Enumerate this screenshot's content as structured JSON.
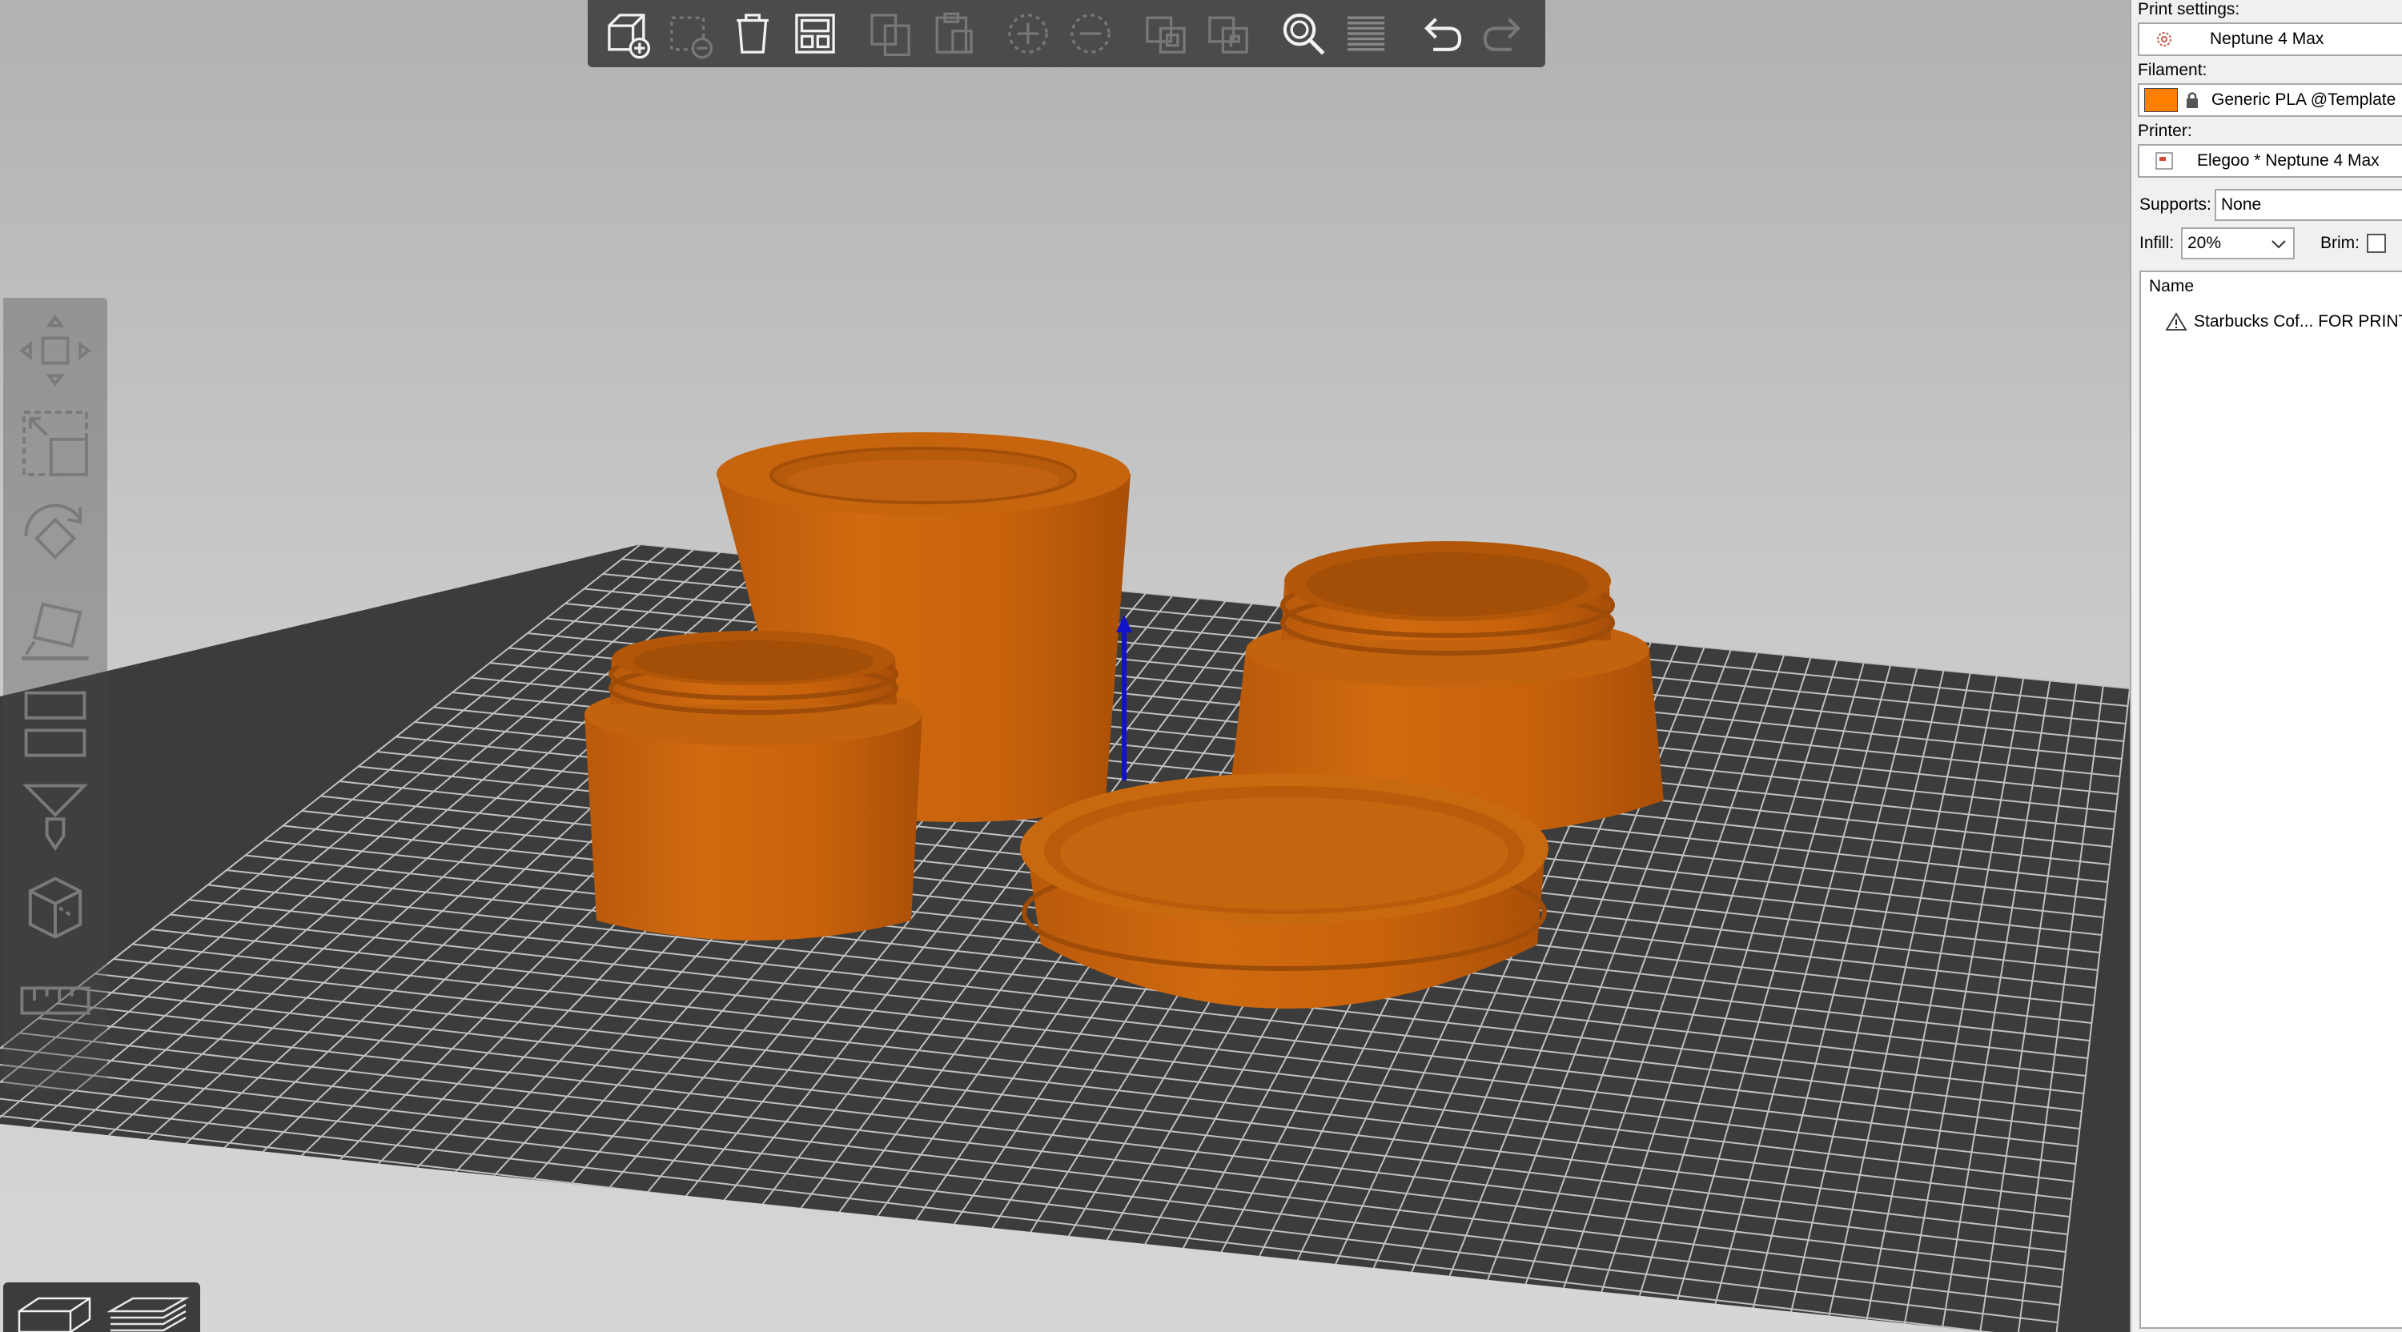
{
  "toolbar": {
    "buttons": [
      {
        "id": "add",
        "icon": "add-object-icon",
        "enabled": true
      },
      {
        "id": "delete",
        "icon": "delete-selection-icon",
        "enabled": false
      },
      {
        "id": "delete_all",
        "icon": "trash-icon",
        "enabled": true
      },
      {
        "id": "arrange",
        "icon": "arrange-icon",
        "enabled": true
      },
      {
        "id": "copy",
        "icon": "copy-icon",
        "enabled": false
      },
      {
        "id": "paste",
        "icon": "paste-icon",
        "enabled": false
      },
      {
        "id": "instance_add",
        "icon": "add-instance-icon",
        "enabled": false
      },
      {
        "id": "instance_remove",
        "icon": "remove-instance-icon",
        "enabled": false
      },
      {
        "id": "split_objects",
        "icon": "split-objects-icon",
        "enabled": false
      },
      {
        "id": "split_parts",
        "icon": "split-parts-icon",
        "enabled": false
      },
      {
        "id": "search",
        "icon": "search-icon",
        "enabled": true
      },
      {
        "id": "layers",
        "icon": "layers-editing-icon",
        "enabled": false
      },
      {
        "id": "undo",
        "icon": "undo-icon",
        "enabled": true
      },
      {
        "id": "redo",
        "icon": "redo-icon",
        "enabled": false
      }
    ]
  },
  "left_toolbar": {
    "tools": [
      "move-icon",
      "scale-icon",
      "rotate-icon",
      "place-on-face-icon",
      "cut-icon",
      "support-paint-icon",
      "seam-paint-icon",
      "measure-icon"
    ]
  },
  "view_toggle": {
    "active": "3d-view"
  },
  "sidebar": {
    "print_settings_label": "Print settings:",
    "print_settings_value": "Neptune 4 Max",
    "filament_label": "Filament:",
    "filament_value": "Generic PLA @Template",
    "filament_color": "#ff8000",
    "printer_label": "Printer:",
    "printer_value": "Elegoo * Neptune 4 Max",
    "supports_label": "Supports:",
    "supports_value": "None",
    "infill_label": "Infill:",
    "infill_value": "20%",
    "brim_label": "Brim:",
    "brim_checked": false,
    "list_header": "Name",
    "object_name": "Starbucks Cof... FOR PRINT.s"
  },
  "colors": {
    "bed": "#3c3c3c",
    "grid_line": "#d8d8d8",
    "model_orange": "#c8620c",
    "z_axis": "#1212c8"
  }
}
